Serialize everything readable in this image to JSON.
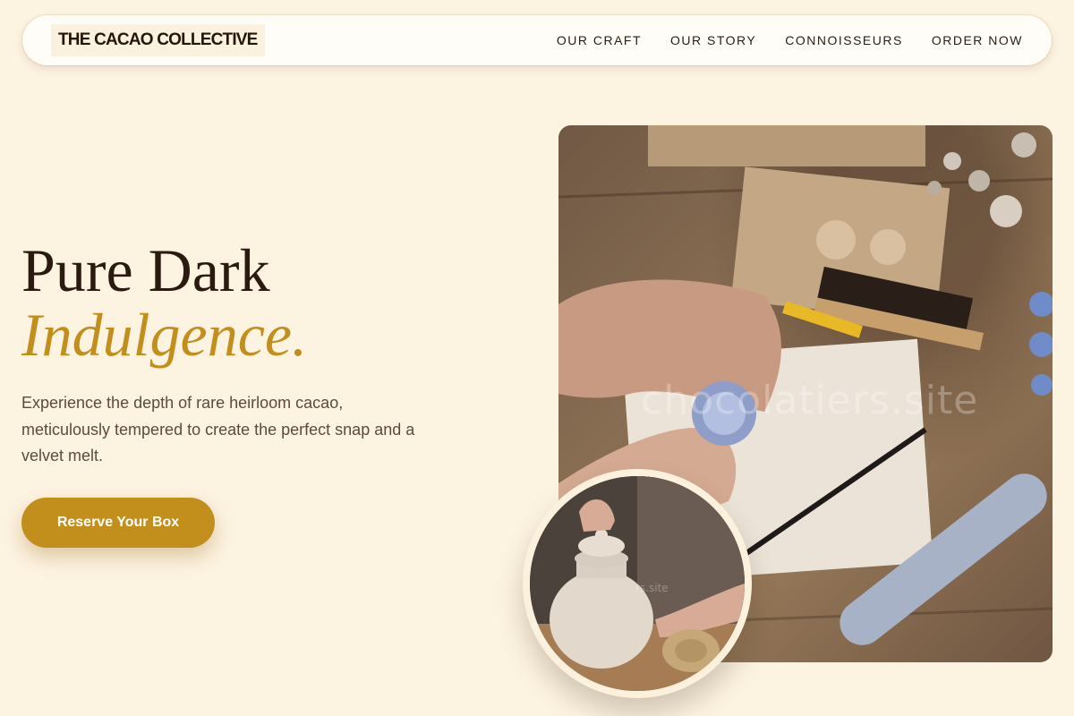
{
  "brand": {
    "logo_text": "THE CACAO COLLECTIVE"
  },
  "nav": {
    "links": [
      "OUR CRAFT",
      "OUR STORY",
      "CONNOISSEURS",
      "ORDER NOW"
    ]
  },
  "hero": {
    "headline_line1": "Pure Dark",
    "headline_line2": "Indulgence.",
    "subtext": "Experience the depth of rare heirloom cacao, meticulously tempered to create the perfect snap and a velvet melt.",
    "cta_label": "Reserve Your Box"
  },
  "images": {
    "main_watermark": "chocolatiers.site",
    "circle_watermark": "rs.site"
  },
  "colors": {
    "background": "#fdf3e1",
    "accent": "#c38f1c",
    "text_dark": "#2a1a10",
    "text_muted": "#5e4a3c"
  }
}
